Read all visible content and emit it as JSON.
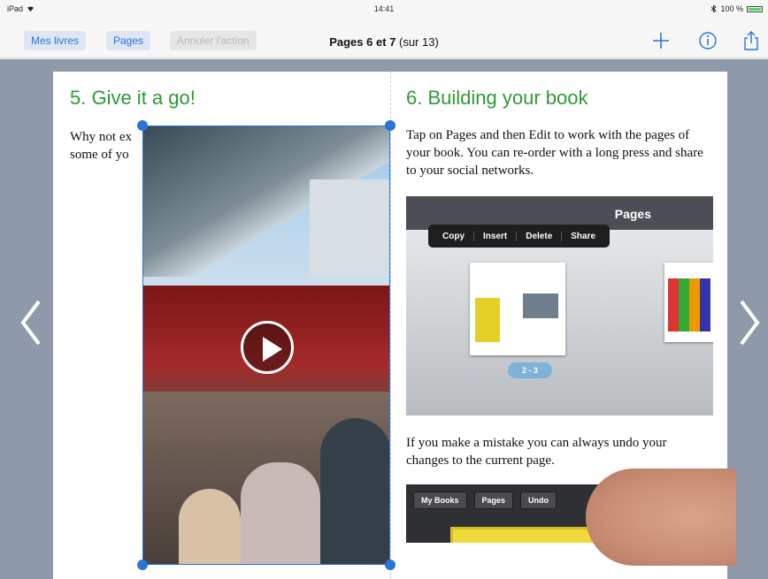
{
  "status": {
    "device": "iPad",
    "time": "14:41",
    "battery": "100 %"
  },
  "toolbar": {
    "my_books": "Mes livres",
    "pages": "Pages",
    "undo": "Annuler l'action",
    "title_bold": "Pages 6 et 7",
    "title_rest": " (sur 13)",
    "icons": [
      "plus-icon",
      "info-icon",
      "share-icon"
    ]
  },
  "left_page": {
    "heading": "5. Give it a go!",
    "text_line1": "Why not ex",
    "text_line2": "some of yo"
  },
  "right_page": {
    "heading": "6. Building your book",
    "paragraph1": "Tap on Pages and then Edit to work with the pages of your book. You can re-order with a long press and share to your social networks.",
    "paragraph2": "If you make a mistake you can always undo your changes to the current page.",
    "screenshot1": {
      "title": "Pages",
      "menu": [
        "Copy",
        "Insert",
        "Delete",
        "Share"
      ],
      "page_pill": "2 - 3"
    },
    "screenshot2": {
      "buttons": [
        "My Books",
        "Pages",
        "Undo"
      ]
    }
  },
  "colors": {
    "accent": "#2a74d8",
    "heading": "#2e9a34",
    "backdrop": "#8e9aa9"
  }
}
